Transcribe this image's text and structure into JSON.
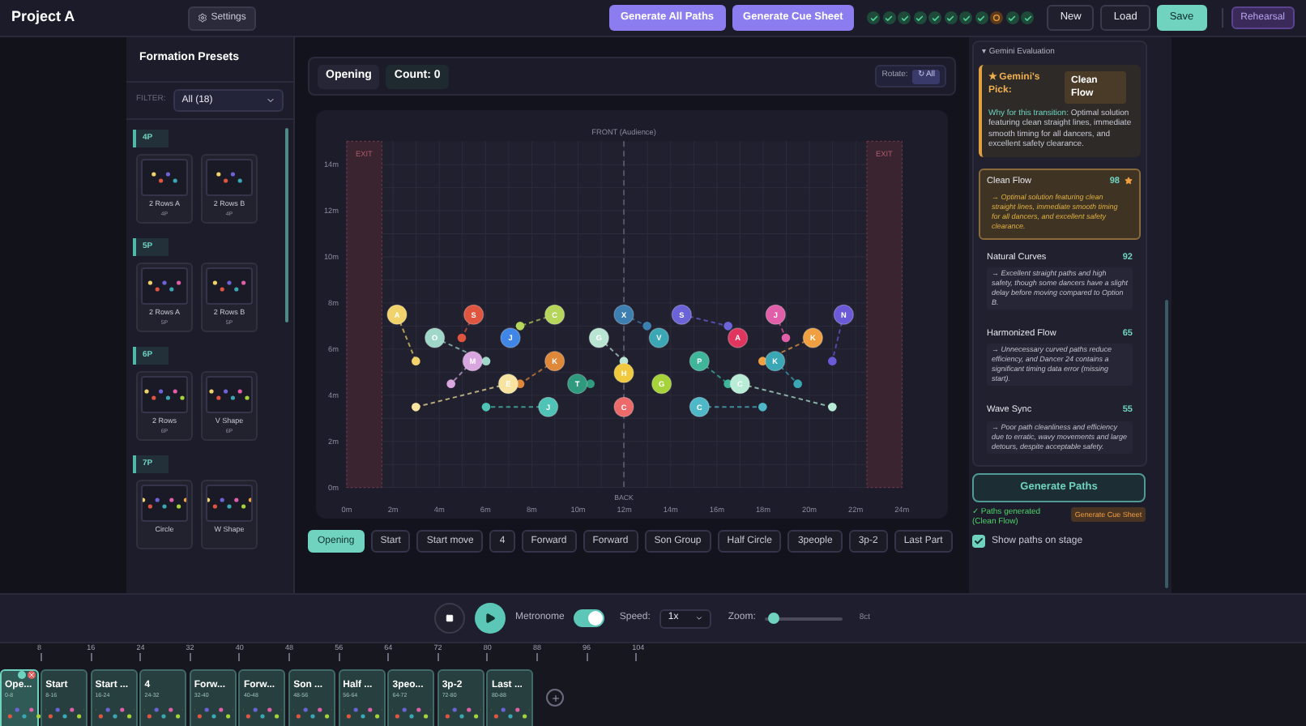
{
  "app_title": "Project A",
  "settings_button": "Settings",
  "action_buttons": [
    {
      "label": "Generate All Paths"
    },
    {
      "label": "Generate Cue Sheet"
    }
  ],
  "cue_checks": [
    {
      "done": true
    },
    {
      "done": true
    },
    {
      "done": true
    },
    {
      "done": true
    },
    {
      "done": true
    },
    {
      "done": true
    },
    {
      "done": true
    },
    {
      "done": true
    },
    {
      "done": false
    },
    {
      "done": true
    },
    {
      "done": true
    }
  ],
  "file_buttons": [
    {
      "label": "New",
      "kind": "plain"
    },
    {
      "label": "Load",
      "kind": "plain"
    },
    {
      "label": "Save",
      "kind": "accent"
    }
  ],
  "mode_button": "Rehearsal",
  "presets": {
    "title": "Formation Presets",
    "filter_label": "FILTER:",
    "filter_value": "All (18)",
    "groups": [
      {
        "label": "4P",
        "items": [
          {
            "name": "2 Rows A",
            "count": "4P"
          },
          {
            "name": "2 Rows B",
            "count": "4P"
          }
        ]
      },
      {
        "label": "5P",
        "items": [
          {
            "name": "2 Rows A",
            "count": "5P"
          },
          {
            "name": "2 Rows B",
            "count": "5P"
          }
        ]
      },
      {
        "label": "6P",
        "items": [
          {
            "name": "2 Rows",
            "count": "6P"
          },
          {
            "name": "V Shape",
            "count": "6P"
          }
        ]
      },
      {
        "label": "7P",
        "items": [
          {
            "name": "Circle"
          },
          {
            "name": "W Shape"
          }
        ]
      }
    ]
  },
  "stage_header": {
    "scene": "Opening",
    "count": "Count: 0",
    "rotate_label": "Rotate:",
    "rotate_button": "↻ All"
  },
  "stage": {
    "front_label": "FRONT (Audience)",
    "back_label": "BACK",
    "exit_labels": [
      "EXIT",
      "EXIT"
    ],
    "y_ticks": [
      "14m",
      "12m",
      "10m",
      "8m",
      "6m",
      "4m",
      "2m",
      "0m"
    ],
    "x_ticks": [
      "0m",
      "2m",
      "4m",
      "6m",
      "8m",
      "10m",
      "12m",
      "14m",
      "16m",
      "18m",
      "20m",
      "22m",
      "24m"
    ],
    "dancers": [
      {
        "label": "A",
        "color": "#f2d36b"
      },
      {
        "label": "S",
        "color": "#e0553f"
      },
      {
        "label": "C",
        "color": "#b5d65a"
      },
      {
        "label": "X",
        "color": "#3d7fb0"
      },
      {
        "label": "S",
        "color": "#6c63d8"
      },
      {
        "label": "J",
        "color": "#e05fa8"
      },
      {
        "label": "N",
        "color": "#6a5ad8"
      },
      {
        "label": "O",
        "color": "#9fd8c8"
      },
      {
        "label": "J",
        "color": "#3f86e6"
      },
      {
        "label": "G",
        "color": "#b9e6d3"
      },
      {
        "label": "V",
        "color": "#3ba7b5"
      },
      {
        "label": "A",
        "color": "#e0355f"
      },
      {
        "label": "K",
        "color": "#f0a040"
      },
      {
        "label": "M",
        "color": "#d9a6e0"
      },
      {
        "label": "K",
        "color": "#e0883a"
      },
      {
        "label": "P",
        "color": "#3fb59a"
      },
      {
        "label": "K",
        "color": "#3ba7b5"
      },
      {
        "label": "E",
        "color": "#f7e4a0"
      },
      {
        "label": "T",
        "color": "#2f9a7e"
      },
      {
        "label": "H",
        "color": "#f0c93f"
      },
      {
        "label": "G",
        "color": "#a6d23a"
      },
      {
        "label": "C",
        "color": "#b8ecd6"
      },
      {
        "label": "J",
        "color": "#4fc3b5"
      },
      {
        "label": "C",
        "color": "#ec6a6a"
      },
      {
        "label": "C",
        "color": "#4fb8c8"
      }
    ]
  },
  "scenes": [
    {
      "label": "Opening",
      "selected": true
    },
    {
      "label": "Start",
      "selected": false
    },
    {
      "label": "Start move",
      "selected": false
    },
    {
      "label": "4",
      "selected": false
    },
    {
      "label": "Forward",
      "selected": false
    },
    {
      "label": "Forward",
      "selected": false
    },
    {
      "label": "Son Group",
      "selected": false
    },
    {
      "label": "Half Circle",
      "selected": false
    },
    {
      "label": "3people",
      "selected": false
    },
    {
      "label": "3p-2",
      "selected": false
    },
    {
      "label": "Last Part",
      "selected": false
    }
  ],
  "evaluation": {
    "title": "▾ Gemini Evaluation",
    "pick_label": "★ Gemini's Pick:",
    "pick_value": "Clean Flow",
    "reason_lead": "Why for this transition:",
    "reason": "Optimal solution featuring clean straight lines, immediate smooth timing for all dancers, and excellent safety clearance.",
    "options": [
      {
        "name": "Clean Flow",
        "score": "98",
        "selected": true,
        "note": "→ Optimal solution featuring clean straight lines, immediate smooth timing for all dancers, and excellent safety clearance."
      },
      {
        "name": "Natural Curves",
        "score": "92",
        "selected": false,
        "note": "→ Excellent straight paths and high safety, though some dancers have a slight delay before moving compared to Option B."
      },
      {
        "name": "Harmonized Flow",
        "score": "65",
        "selected": false,
        "note": "→ Unnecessary curved paths reduce efficiency, and Dancer 24 contains a significant timing data error (missing start)."
      },
      {
        "name": "Wave Sync",
        "score": "55",
        "selected": false,
        "note": "→ Poor path cleanliness and efficiency due to erratic, wavy movements and large detours, despite acceptable safety."
      }
    ],
    "generate_button": "Generate Paths",
    "status": "✓ Paths generated (Clean Flow)",
    "cue_button": "Generate Cue Sheet",
    "show_paths": {
      "label": "Show paths on stage",
      "checked": true
    }
  },
  "transport": {
    "metronome_label": "Metronome",
    "metronome_on": true,
    "speed_label": "Speed:",
    "speed_value": "1x",
    "zoom_label": "Zoom:",
    "zoom": {
      "level": 0.1
    },
    "zoom_reading": "8ct"
  },
  "timeline": {
    "ticks": [
      "8",
      "16",
      "24",
      "32",
      "40",
      "48",
      "56",
      "64",
      "72",
      "80",
      "88",
      "96",
      "104"
    ],
    "clips": [
      {
        "name": "Ope...",
        "range": "0-8",
        "selected": true
      },
      {
        "name": "Start",
        "range": "8-16",
        "selected": false
      },
      {
        "name": "Start ...",
        "range": "16-24",
        "selected": false
      },
      {
        "name": "4",
        "range": "24-32",
        "selected": false
      },
      {
        "name": "Forw...",
        "range": "32-40",
        "selected": false
      },
      {
        "name": "Forw...",
        "range": "40-48",
        "selected": false
      },
      {
        "name": "Son ...",
        "range": "48-56",
        "selected": false
      },
      {
        "name": "Half ...",
        "range": "56-64",
        "selected": false
      },
      {
        "name": "3peo...",
        "range": "64-72",
        "selected": false
      },
      {
        "name": "3p-2",
        "range": "72-80",
        "selected": false
      },
      {
        "name": "Last ...",
        "range": "80-88",
        "selected": false
      }
    ]
  }
}
